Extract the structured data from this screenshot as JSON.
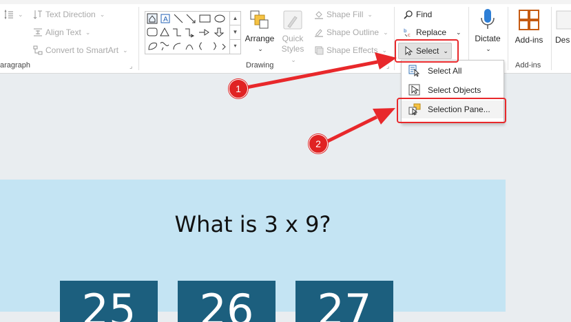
{
  "ribbon": {
    "paragraph": {
      "text_direction": "Text Direction",
      "align_text": "Align Text",
      "convert_smartart": "Convert to SmartArt",
      "group_label": "aragraph"
    },
    "drawing": {
      "arrange": "Arrange",
      "quick_styles_line1": "Quick",
      "quick_styles_line2": "Styles",
      "shape_fill": "Shape Fill",
      "shape_outline": "Shape Outline",
      "shape_effects": "Shape Effects",
      "group_label": "Drawing"
    },
    "editing": {
      "find": "Find",
      "replace": "Replace",
      "select": "Select"
    },
    "voice": {
      "dictate": "Dictate"
    },
    "addins": {
      "button": "Add-ins",
      "group_label": "Add-ins"
    },
    "designer": {
      "label": "Des"
    }
  },
  "select_menu": {
    "items": [
      {
        "label": "Select All",
        "icon": "select-all-icon"
      },
      {
        "label": "Select Objects",
        "icon": "select-objects-icon"
      },
      {
        "label": "Selection Pane...",
        "icon": "selection-pane-icon"
      }
    ]
  },
  "slide": {
    "title": "What is 3 x 9?",
    "answers": [
      "25",
      "26",
      "27"
    ]
  },
  "callouts": [
    "1",
    "2"
  ],
  "colors": {
    "accent_red": "#e8282b",
    "slide_bg": "#c4e4f3",
    "answer_box": "#1c5f7e"
  }
}
